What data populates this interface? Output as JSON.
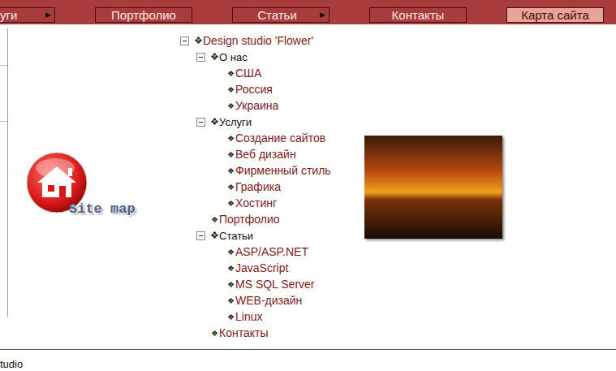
{
  "nav": [
    {
      "label": "уги",
      "arrow": "▶",
      "selected": false
    },
    {
      "label": "Портфолио",
      "arrow": "",
      "selected": false
    },
    {
      "label": "Статьи",
      "arrow": "▶",
      "selected": false
    },
    {
      "label": "Контакты",
      "arrow": "",
      "selected": false
    },
    {
      "label": "Карта сайта",
      "arrow": "",
      "selected": true
    }
  ],
  "logo": {
    "caption": "Site map"
  },
  "tree": {
    "label": "Design studio 'Flower'",
    "bullet": "❖",
    "kind": "root",
    "expanded": true,
    "children": [
      {
        "label": "О нас",
        "bullet": "❖",
        "kind": "branch",
        "expanded": true,
        "children": [
          {
            "label": "США",
            "bullet": "❖",
            "kind": "leaf",
            "expanded": false,
            "children": []
          },
          {
            "label": "Россия",
            "bullet": "❖",
            "kind": "leaf",
            "expanded": false,
            "children": []
          },
          {
            "label": "Украина",
            "bullet": "❖",
            "kind": "leaf",
            "expanded": false,
            "children": []
          }
        ]
      },
      {
        "label": "Услуги",
        "bullet": "❖",
        "kind": "branch",
        "expanded": true,
        "children": [
          {
            "label": "Создание сайтов",
            "bullet": "❖",
            "kind": "leaf",
            "expanded": false,
            "children": []
          },
          {
            "label": "Веб дизайн",
            "bullet": "❖",
            "kind": "leaf",
            "expanded": false,
            "children": []
          },
          {
            "label": "Фирменный стиль",
            "bullet": "❖",
            "kind": "leaf",
            "expanded": false,
            "children": []
          },
          {
            "label": "Графика",
            "bullet": "❖",
            "kind": "leaf",
            "expanded": false,
            "children": []
          },
          {
            "label": "Хостинг",
            "bullet": "❖",
            "kind": "leaf",
            "expanded": false,
            "children": []
          }
        ]
      },
      {
        "label": "Портфолио",
        "bullet": "❖",
        "kind": "leaf",
        "expanded": false,
        "children": []
      },
      {
        "label": "Статьи",
        "bullet": "❖",
        "kind": "branch",
        "expanded": true,
        "children": [
          {
            "label": "ASP/ASP.NET",
            "bullet": "❖",
            "kind": "leaf",
            "expanded": false,
            "children": []
          },
          {
            "label": "JavaScript",
            "bullet": "❖",
            "kind": "leaf",
            "expanded": false,
            "children": []
          },
          {
            "label": "MS SQL Server",
            "bullet": "❖",
            "kind": "leaf",
            "expanded": false,
            "children": []
          },
          {
            "label": "WEB-дизайн",
            "bullet": "❖",
            "kind": "leaf",
            "expanded": false,
            "children": []
          },
          {
            "label": "Linux",
            "bullet": "❖",
            "kind": "leaf",
            "expanded": false,
            "children": []
          }
        ]
      },
      {
        "label": "Контакты",
        "bullet": "❖",
        "kind": "leaf",
        "expanded": false,
        "children": []
      }
    ]
  },
  "footer": "tudio"
}
